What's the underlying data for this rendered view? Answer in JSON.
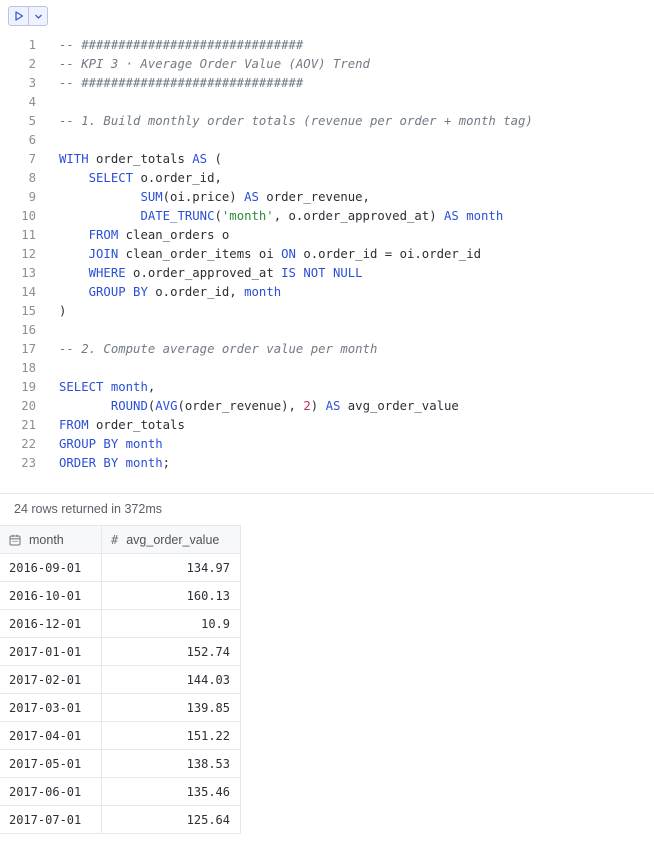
{
  "toolbar": {
    "run_icon": "play-icon",
    "menu_icon": "chevron-down-icon"
  },
  "editor": {
    "lines": [
      {
        "n": "1",
        "tokens": [
          {
            "t": "-- ##############################",
            "c": "cm"
          }
        ]
      },
      {
        "n": "2",
        "tokens": [
          {
            "t": "-- KPI 3 · Average Order Value (AOV) Trend",
            "c": "cm"
          }
        ]
      },
      {
        "n": "3",
        "tokens": [
          {
            "t": "-- ##############################",
            "c": "cm"
          }
        ]
      },
      {
        "n": "4",
        "tokens": []
      },
      {
        "n": "5",
        "tokens": [
          {
            "t": "-- 1. Build monthly order totals (revenue per order + month tag)",
            "c": "cm"
          }
        ]
      },
      {
        "n": "6",
        "tokens": []
      },
      {
        "n": "7",
        "tokens": [
          {
            "t": "WITH",
            "c": "kw"
          },
          {
            "t": " order_totals "
          },
          {
            "t": "AS",
            "c": "kw"
          },
          {
            "t": " ("
          }
        ]
      },
      {
        "n": "8",
        "tokens": [
          {
            "t": "    "
          },
          {
            "t": "SELECT",
            "c": "kw"
          },
          {
            "t": " o.order_id,"
          }
        ]
      },
      {
        "n": "9",
        "tokens": [
          {
            "t": "           "
          },
          {
            "t": "SUM",
            "c": "fn"
          },
          {
            "t": "(oi.price) "
          },
          {
            "t": "AS",
            "c": "kw"
          },
          {
            "t": " order_revenue,"
          }
        ]
      },
      {
        "n": "10",
        "tokens": [
          {
            "t": "           "
          },
          {
            "t": "DATE_TRUNC",
            "c": "fn"
          },
          {
            "t": "("
          },
          {
            "t": "'month'",
            "c": "str"
          },
          {
            "t": ", o.order_approved_at) "
          },
          {
            "t": "AS",
            "c": "kw"
          },
          {
            "t": " "
          },
          {
            "t": "month",
            "c": "kw"
          }
        ]
      },
      {
        "n": "11",
        "tokens": [
          {
            "t": "    "
          },
          {
            "t": "FROM",
            "c": "kw"
          },
          {
            "t": " clean_orders o"
          }
        ]
      },
      {
        "n": "12",
        "tokens": [
          {
            "t": "    "
          },
          {
            "t": "JOIN",
            "c": "kw"
          },
          {
            "t": " clean_order_items oi "
          },
          {
            "t": "ON",
            "c": "kw"
          },
          {
            "t": " o.order_id = oi.order_id"
          }
        ]
      },
      {
        "n": "13",
        "tokens": [
          {
            "t": "    "
          },
          {
            "t": "WHERE",
            "c": "kw"
          },
          {
            "t": " o.order_approved_at "
          },
          {
            "t": "IS NOT NULL",
            "c": "kw"
          }
        ]
      },
      {
        "n": "14",
        "tokens": [
          {
            "t": "    "
          },
          {
            "t": "GROUP BY",
            "c": "kw"
          },
          {
            "t": " o.order_id, "
          },
          {
            "t": "month",
            "c": "kw"
          }
        ]
      },
      {
        "n": "15",
        "tokens": [
          {
            "t": ")"
          }
        ]
      },
      {
        "n": "16",
        "tokens": []
      },
      {
        "n": "17",
        "tokens": [
          {
            "t": "-- 2. Compute average order value per month",
            "c": "cm"
          }
        ]
      },
      {
        "n": "18",
        "tokens": []
      },
      {
        "n": "19",
        "tokens": [
          {
            "t": "SELECT",
            "c": "kw"
          },
          {
            "t": " "
          },
          {
            "t": "month",
            "c": "kw"
          },
          {
            "t": ","
          }
        ]
      },
      {
        "n": "20",
        "tokens": [
          {
            "t": "       "
          },
          {
            "t": "ROUND",
            "c": "fn"
          },
          {
            "t": "("
          },
          {
            "t": "AVG",
            "c": "fn"
          },
          {
            "t": "(order_revenue), "
          },
          {
            "t": "2",
            "c": "num"
          },
          {
            "t": ") "
          },
          {
            "t": "AS",
            "c": "kw"
          },
          {
            "t": " avg_order_value"
          }
        ]
      },
      {
        "n": "21",
        "tokens": [
          {
            "t": "FROM",
            "c": "kw"
          },
          {
            "t": " order_totals"
          }
        ]
      },
      {
        "n": "22",
        "tokens": [
          {
            "t": "GROUP BY",
            "c": "kw"
          },
          {
            "t": " "
          },
          {
            "t": "month",
            "c": "kw"
          }
        ]
      },
      {
        "n": "23",
        "tokens": [
          {
            "t": "ORDER BY",
            "c": "kw"
          },
          {
            "t": " "
          },
          {
            "t": "month",
            "c": "kw"
          },
          {
            "t": ";"
          }
        ]
      }
    ]
  },
  "results": {
    "status": "24 rows returned in 372ms",
    "columns": [
      {
        "label": "month",
        "icon": "calendar-icon"
      },
      {
        "label": "avg_order_value",
        "icon": "#"
      }
    ],
    "rows": [
      [
        "2016-09-01",
        "134.97"
      ],
      [
        "2016-10-01",
        "160.13"
      ],
      [
        "2016-12-01",
        "10.9"
      ],
      [
        "2017-01-01",
        "152.74"
      ],
      [
        "2017-02-01",
        "144.03"
      ],
      [
        "2017-03-01",
        "139.85"
      ],
      [
        "2017-04-01",
        "151.22"
      ],
      [
        "2017-05-01",
        "138.53"
      ],
      [
        "2017-06-01",
        "135.46"
      ],
      [
        "2017-07-01",
        "125.64"
      ]
    ]
  },
  "colors": {
    "keyword": "#2b4fd6",
    "comment": "#727a85",
    "string": "#2f8a3a",
    "number": "#b8325c"
  }
}
